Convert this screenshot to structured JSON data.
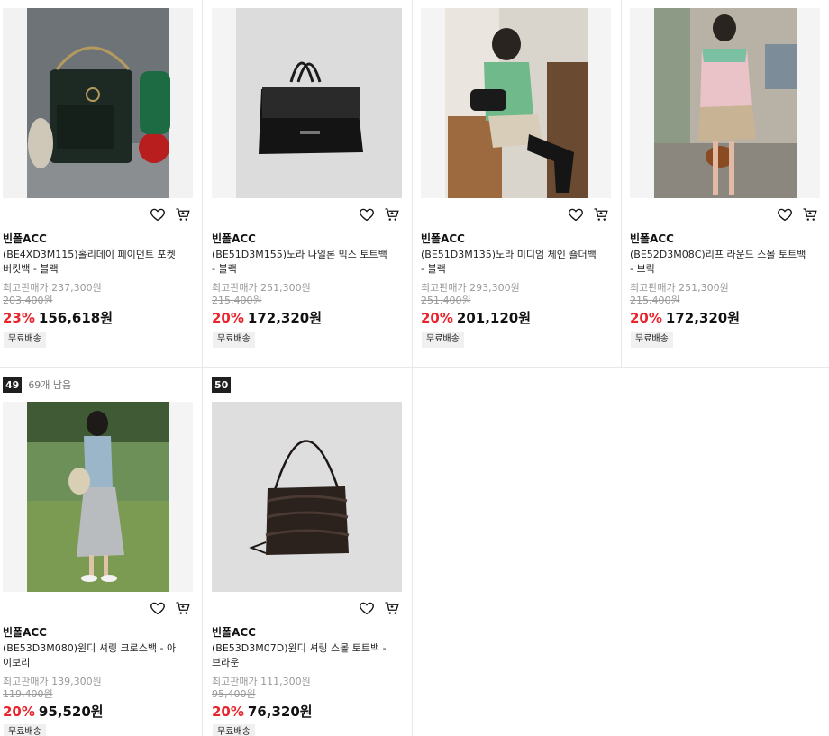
{
  "products": [
    {
      "rank": "",
      "remaining": "",
      "brand": "빈폴ACC",
      "title": "(BE4XD3M115)홀리데이 페이던트 포켓 버킷백 - 블랙",
      "prev_price_label": "최고판매가 237,300원",
      "original_price": "203,400원",
      "discount": "23%",
      "price": "156,618원",
      "badge": "무료배송",
      "image": "holiday-bucket-bag"
    },
    {
      "rank": "",
      "remaining": "",
      "brand": "빈폴ACC",
      "title": "(BE51D3M155)노라 나일론 믹스 토트백 - 블랙",
      "prev_price_label": "최고판매가 251,300원",
      "original_price": "215,400원",
      "discount": "20%",
      "price": "172,320원",
      "badge": "무료배송",
      "image": "black-tote"
    },
    {
      "rank": "",
      "remaining": "",
      "brand": "빈폴ACC",
      "title": "(BE51D3M135)노라 미디엄 체인 숄더백 - 블랙",
      "prev_price_label": "최고판매가 293,300원",
      "original_price": "251,400원",
      "discount": "20%",
      "price": "201,120원",
      "badge": "무료배송",
      "image": "model-green-shirt"
    },
    {
      "rank": "",
      "remaining": "",
      "brand": "빈폴ACC",
      "title": "(BE52D3M08C)리프 라운드 스몰 토트백 - 브릭",
      "prev_price_label": "최고판매가 251,300원",
      "original_price": "215,400원",
      "discount": "20%",
      "price": "172,320원",
      "badge": "무료배송",
      "image": "model-street"
    },
    {
      "rank": "49",
      "remaining": "69개 남음",
      "brand": "빈폴ACC",
      "title": "(BE53D3M080)윈디 셔링 크로스백 - 아이보리",
      "prev_price_label": "최고판매가 139,300원",
      "original_price": "119,400원",
      "discount": "20%",
      "price": "95,520원",
      "badge": "무료배송",
      "image": "model-garden"
    },
    {
      "rank": "50",
      "remaining": "",
      "brand": "빈폴ACC",
      "title": "(BE53D3M07D)윈디 셔링 스몰 토트백 - 브라운",
      "prev_price_label": "최고판매가 111,300원",
      "original_price": "95,400원",
      "discount": "20%",
      "price": "76,320원",
      "badge": "무료배송",
      "image": "brown-shirred-bag"
    }
  ],
  "icons": {
    "wishlist": "heart-icon",
    "cart": "cart-icon"
  },
  "colors": {
    "discount": "#e9242c",
    "rank_badge": "#1f1f1f",
    "badge_bg": "#f0f0f0"
  }
}
